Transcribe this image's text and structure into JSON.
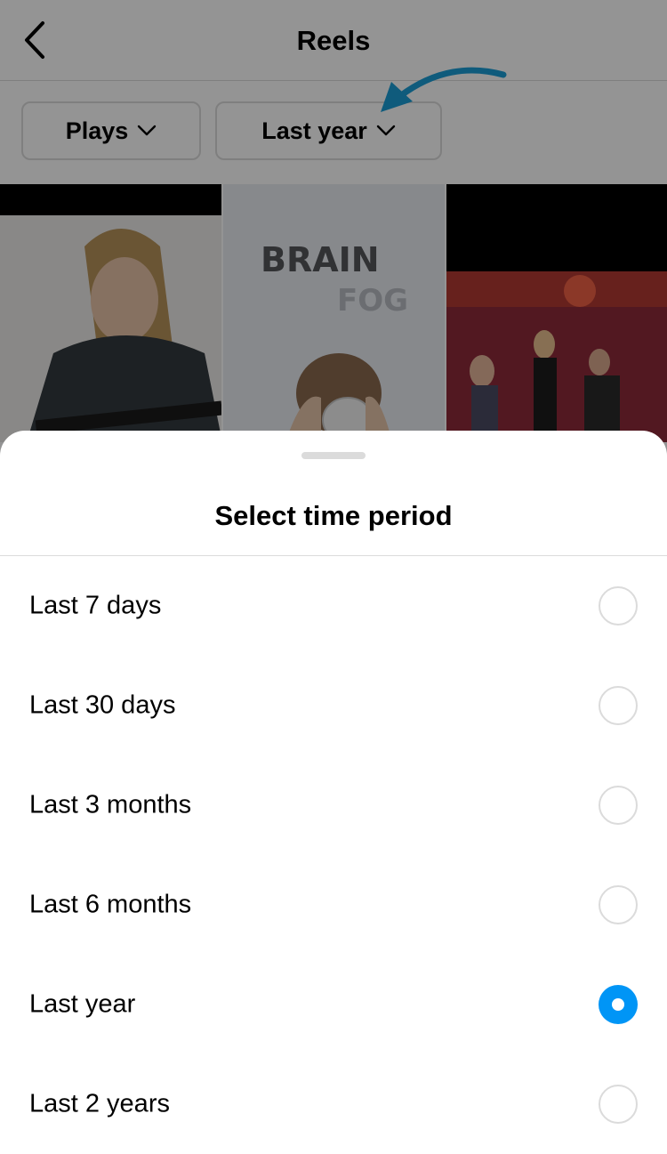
{
  "header": {
    "title": "Reels",
    "back_icon": "chevron-left-icon"
  },
  "filters": {
    "metric_label": "Plays",
    "period_label": "Last year",
    "dropdown_icon": "chevron-down-icon"
  },
  "annotation": {
    "arrow_color": "#1a9ed6"
  },
  "thumbnails": [
    {
      "id": "reel-1"
    },
    {
      "id": "reel-2",
      "text_lines": [
        "BRAIN",
        "FOG"
      ]
    },
    {
      "id": "reel-3"
    }
  ],
  "sheet": {
    "title": "Select time period",
    "options": [
      {
        "label": "Last 7 days",
        "selected": false
      },
      {
        "label": "Last 30 days",
        "selected": false
      },
      {
        "label": "Last 3 months",
        "selected": false
      },
      {
        "label": "Last 6 months",
        "selected": false
      },
      {
        "label": "Last year",
        "selected": true
      },
      {
        "label": "Last 2 years",
        "selected": false
      }
    ]
  },
  "colors": {
    "accent": "#0095f6",
    "divider": "#dbdbdb"
  }
}
